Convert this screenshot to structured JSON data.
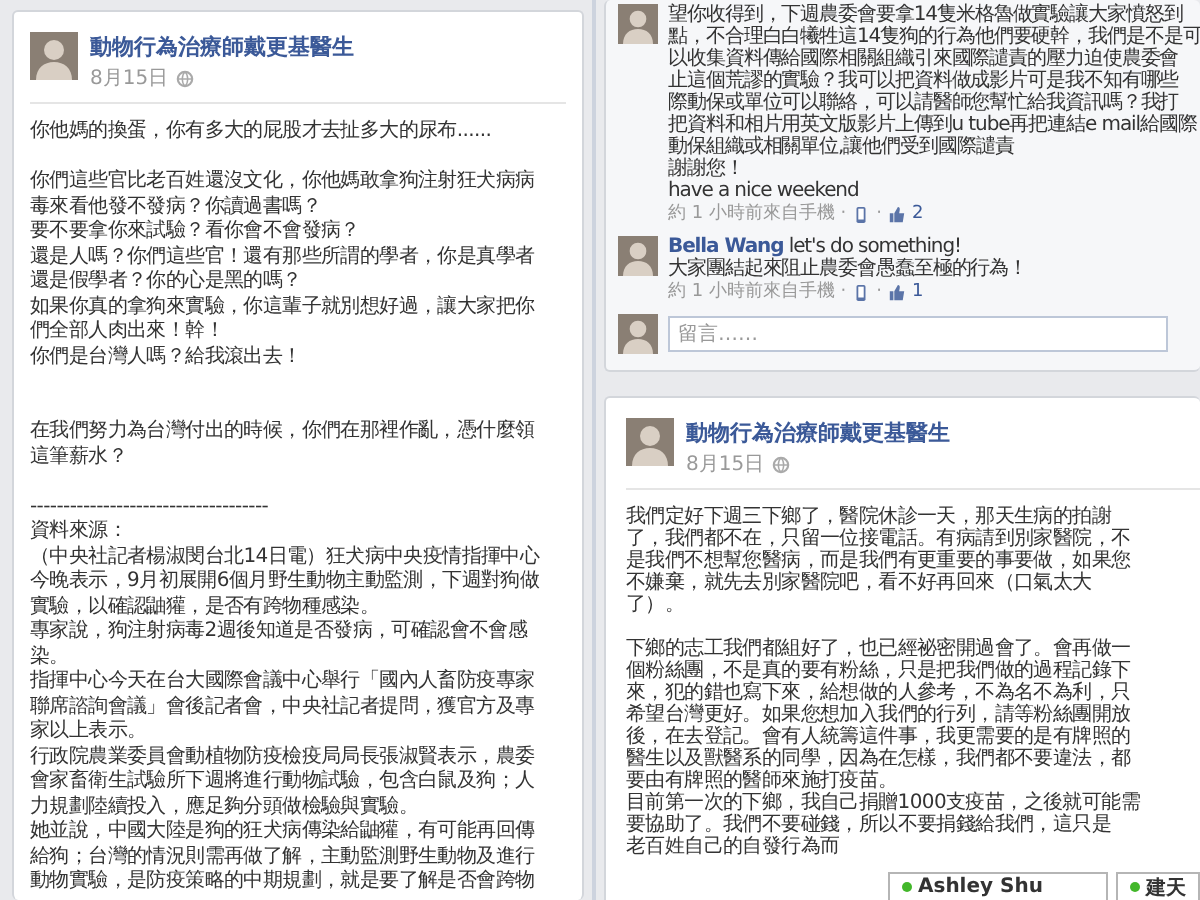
{
  "left_post": {
    "author": "動物行為治療師戴更基醫生",
    "date": "8月15日",
    "paragraphs": [
      {
        "kind": "paragraph",
        "lines": [
          "你他媽的換蛋，你有多大的屁股才去扯多大的尿布......"
        ]
      },
      {
        "kind": "paragraph",
        "lines": [
          "你們這些官比老百姓還沒文化，你他媽敢拿狗注射狂犬病病",
          "毒來看他發不發病？你讀過書嗎？",
          "要不要拿你來試驗？看你會不會發病？",
          "還是人嗎？你們這些官！還有那些所謂的學者，你是真學者",
          "還是假學者？你的心是黑的嗎？",
          "如果你真的拿狗來實驗，你這輩子就別想好過，讓大家把你",
          "們全部人肉出來！幹！",
          "你們是台灣人嗎？給我滾出去！"
        ]
      },
      {
        "kind": "section",
        "lines": [
          "在我們努力為台灣付出的時候，你們在那裡作亂，憑什麼領",
          "這筆薪水？"
        ]
      },
      {
        "kind": "paragraph",
        "lines": [
          "------------------------------------",
          "資料來源：",
          "（中央社記者楊淑閔台北14日電）狂犬病中央疫情指揮中心",
          "今晚表示，9月初展開6個月野生動物主動監測，下週對狗做",
          "實驗，以確認鼬獾，是否有跨物種感染。",
          "專家說，狗注射病毒2週後知道是否發病，可確認會不會感",
          "染。",
          "指揮中心今天在台大國際會議中心舉行「國內人畜防疫專家",
          "聯席諮詢會議」會後記者會，中央社記者提問，獲官方及專",
          "家以上表示。",
          "行政院農業委員會動植物防疫檢疫局局長張淑賢表示，農委",
          "會家畜衛生試驗所下週將進行動物試驗，包含白鼠及狗；人",
          "力規劃陸續投入，應足夠分頭做檢驗與實驗。",
          "她並說，中國大陸是狗的狂犬病傳染給鼬獾，有可能再回傳",
          "給狗；台灣的情況則需再做了解，主動監測野生動物及進行",
          "動物實驗，是防疫策略的中期規劃，就是要了解是否會跨物"
        ]
      }
    ]
  },
  "comments_card": {
    "comments": [
      {
        "lines": [
          "望你收得到，下週農委會要拿14隻米格魯做實驗讓大家憤怒到",
          "點，不合理白白犧牲這14隻狗的行為他們要硬幹，我們是不是可",
          "以收集資料傳給國際相關組織引來國際譴責的壓力迫使農委會",
          "止這個荒謬的實驗？我可以把資料做成影片可是我不知有哪些",
          "際動保或單位可以聯絡，可以請醫師您幫忙給我資訊嗎？我打",
          "把資料和相片用英文版影片上傳到u tube再把連結e mail給國際",
          "動保組織或相關單位,讓他們受到國際譴責",
          "謝謝您！",
          "have a nice weekend"
        ],
        "meta": "約 1 小時前來自手機 ·",
        "separator": "·",
        "likes": "2"
      },
      {
        "author": "Bella Wang",
        "lines": [
          "let's do something!",
          "大家團結起來阻止農委會愚蠢至極的行為！"
        ],
        "meta": "約 1 小時前來自手機 ·",
        "separator": "·",
        "likes": "1"
      }
    ],
    "comment_box": {
      "placeholder": "留言……"
    }
  },
  "right_post": {
    "author": "動物行為治療師戴更基醫生",
    "date": "8月15日",
    "paragraphs": [
      {
        "kind": "paragraph",
        "lines": [
          "我們定好下週三下鄉了，醫院休診一天，那天生病的拍謝",
          "了，我們都不在，只留一位接電話。有病請到別家醫院，不",
          "是我們不想幫您醫病，而是我們有更重要的事要做，如果您",
          "不嫌棄，就先去別家醫院吧，看不好再回來（口氣太大",
          "了）。"
        ]
      },
      {
        "kind": "paragraph",
        "lines": [
          "下鄉的志工我們都組好了，也已經祕密開過會了。會再做一",
          "個粉絲團，不是真的要有粉絲，只是把我們做的過程記錄下",
          "來，犯的錯也寫下來，給想做的人參考，不為名不為利，只",
          "希望台灣更好。如果您想加入我們的行列，請等粉絲團開放",
          "後，在去登記。會有人統籌這件事，我更需要的是有牌照的",
          "醫生以及獸醫系的同學，因為在怎樣，我們都不要違法，都",
          "要由有牌照的醫師來施打疫苗。",
          "目前第一次的下鄉，我自己捐贈1000支疫苗，之後就可能需",
          "要協助了。我們不要碰錢，所以不要捐錢給我們，這只是",
          "老百姓自己的自發行為而"
        ]
      }
    ]
  },
  "chat_tabs": [
    {
      "name": "Ashley Shu",
      "online": true
    },
    {
      "name": "建天",
      "online": true
    }
  ]
}
